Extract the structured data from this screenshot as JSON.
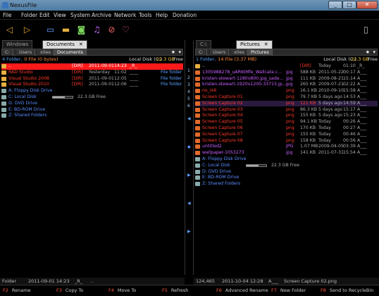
{
  "window": {
    "title": "NexusFile"
  },
  "menu": [
    "File",
    "Folder",
    "Edit",
    "View",
    "System",
    "Archive",
    "Network",
    "Tools",
    "Help",
    "Donation"
  ],
  "toolbar": {
    "icons": [
      "back-icon",
      "forward-icon",
      "monitor-icon",
      "folder-icon",
      "camera-icon",
      "music-icon",
      "no-icon",
      "heart-icon",
      "trash-icon"
    ]
  },
  "left": {
    "tabs": [
      {
        "label": "Windows"
      },
      {
        "label": "Documents"
      }
    ],
    "crumbs": [
      "C:",
      "Users",
      "xiles",
      "Documents"
    ],
    "info": {
      "count_a": "4",
      "folder_word": "Folder,",
      "count_b": "0",
      "rest": "File (0 bytes)",
      "drive": "Local Disk (C:)",
      "free": "22.3 GB",
      "free_word": "Free"
    },
    "rows": [
      {
        "name": "..",
        "c1": "[DIR]",
        "c2": "2011-09-01",
        "c3": "14:23",
        "c4": "_R_",
        "style": "sel"
      },
      {
        "name": "RAD Studio",
        "c1": "[DIR]",
        "c2": "Yesterday",
        "c3": "11:02",
        "c4": "____",
        "c5": "File folder",
        "style": "red"
      },
      {
        "name": "Visual Studio 2008",
        "c1": "[DIR]",
        "c2": "2011-09-01",
        "c3": "12:05",
        "c4": "____",
        "c5": "File folder",
        "style": "red"
      },
      {
        "name": "Visual Studio 2010",
        "c1": "[DIR]",
        "c2": "2011-09-01",
        "c3": "12:06",
        "c4": "____",
        "c5": "File folder",
        "style": "red"
      },
      {
        "name": "A: Floppy Disk Drive",
        "style": "drive"
      },
      {
        "name": "C: Local Disk",
        "free": "22.3 GB Free",
        "usage": 0.6,
        "style": "drive"
      },
      {
        "name": "D: DVD Drive",
        "style": "drive"
      },
      {
        "name": "E: BD-ROM Drive",
        "style": "drive"
      },
      {
        "name": "Z: Shared Folders",
        "style": "drive"
      }
    ],
    "status": {
      "a": "Folder",
      "b": "2011-09-01 14:23",
      "c": "_R_",
      "d": ".."
    }
  },
  "right": {
    "tabs": [
      {
        "label": "C:\\"
      },
      {
        "label": "Pictures"
      }
    ],
    "crumbs": [
      "C:",
      "Users",
      "xiles",
      "Pictures"
    ],
    "info": {
      "count_a": "1",
      "folder_word": "Folder,",
      "count_b": "14",
      "rest": "File (3.37 MB)",
      "drive": "Local Disk (C:)",
      "free": "22.3 GB",
      "free_word": "Free"
    },
    "rows": [
      {
        "name": "..",
        "c1": "[DIR]",
        "c2": "Today",
        "c3": "01:10",
        "c4": "_R_",
        "style": "white"
      },
      {
        "name": "1305988278_uAR6tMfe_Wallcate.c...",
        "c0": "jpg",
        "c1": "588 KB",
        "c2": "2011-05-22",
        "c3": "00:17",
        "c4": "A___",
        "style": "purple"
      },
      {
        "name": "kristen-stewart-1280x800.jpg_sade...",
        "c0": "jpg",
        "c1": "111 KB",
        "c2": "2009-08-21",
        "c3": "15:14",
        "c4": "A___",
        "style": "purple"
      },
      {
        "name": "kristen-stewart-1920x1200-33715.jp...",
        "c0": "jpg",
        "c1": "265 KB",
        "c2": "2009-07-21",
        "c3": "02:22",
        "c4": "A___",
        "style": "purple"
      },
      {
        "name": "no_ie6",
        "c0": "png",
        "c1": "16.1 KB",
        "c2": "2010-09-10",
        "c3": "15:58",
        "c4": "A___",
        "style": "red"
      },
      {
        "name": "Screen Capture 01",
        "c0": "png",
        "c1": "79.7 KB",
        "c2": "5 days ago",
        "c3": "14:53",
        "c4": "A___",
        "style": "red"
      },
      {
        "name": "Screen Capture 02",
        "c0": "png",
        "c1": "121 KB",
        "c2": "5 days ago",
        "c3": "14:59",
        "c4": "A___",
        "style": "hl"
      },
      {
        "name": "Screen Capture 03",
        "c0": "png",
        "c1": "86.3 KB",
        "c2": "5 days ago",
        "c3": "15:17",
        "c4": "A___",
        "style": "red"
      },
      {
        "name": "Screen Capture 04",
        "c0": "png",
        "c1": "155 KB",
        "c2": "5 days ago",
        "c3": "15:23",
        "c4": "A___",
        "style": "red"
      },
      {
        "name": "Screen Capture 05",
        "c0": "png",
        "c1": "94.1 KB",
        "c2": "Today",
        "c3": "00:26",
        "c4": "A___",
        "style": "red"
      },
      {
        "name": "Screen Capture 06",
        "c0": "png",
        "c1": "170 KB",
        "c2": "Today",
        "c3": "00:27",
        "c4": "A___",
        "style": "red"
      },
      {
        "name": "Screen Capture 07",
        "c0": "png",
        "c1": "155 KB",
        "c2": "Today",
        "c3": "00:46",
        "c4": "A___",
        "style": "red"
      },
      {
        "name": "Screen Capture 08",
        "c0": "png",
        "c1": "158 KB",
        "c2": "Today",
        "c3": "00:56",
        "c4": "A___",
        "style": "red"
      },
      {
        "name": "untitled2",
        "c0": "JPG",
        "c1": "1.07 MB",
        "c2": "2009-04-05",
        "c3": "03:39",
        "c4": "A___",
        "style": "purple"
      },
      {
        "name": "wallpaper-1053273",
        "c0": "jpg",
        "c1": "141 KB",
        "c2": "2011-07-31",
        "c3": "15:54",
        "c4": "A___",
        "style": "purple"
      },
      {
        "name": "A: Floppy Disk Drive",
        "style": "drive"
      },
      {
        "name": "C: Local Disk",
        "free": "22.3 GB Free",
        "usage": 0.6,
        "style": "drive"
      },
      {
        "name": "D: DVD Drive",
        "style": "drive"
      },
      {
        "name": "E: BD-ROM Drive",
        "style": "drive"
      },
      {
        "name": "Z: Shared Folders",
        "style": "drive"
      }
    ],
    "status": {
      "a": "124,465",
      "b": "2011-10-04 12:28",
      "c": "A___",
      "d": "Screen Capture 02.png"
    }
  },
  "fkeys": [
    {
      "key": "F2",
      "label": "Rename"
    },
    {
      "key": "F3",
      "label": "Copy To"
    },
    {
      "key": "F4",
      "label": "Move To"
    },
    {
      "key": "F5",
      "label": "Refresh"
    },
    {
      "key": "F6",
      "label": "Advanced Rename"
    },
    {
      "key": "F7",
      "label": "New Folder"
    },
    {
      "key": "F8",
      "label": "Send to RecycleBin"
    }
  ],
  "divider_labels": [
    "1",
    "2",
    "3",
    "4",
    "5",
    "6"
  ],
  "colors": {
    "red": "#ff3a2a",
    "purple": "#c860ff",
    "drive": "#5c8cff",
    "blue": "#5aa0ff",
    "yellow": "#ffd23a"
  }
}
